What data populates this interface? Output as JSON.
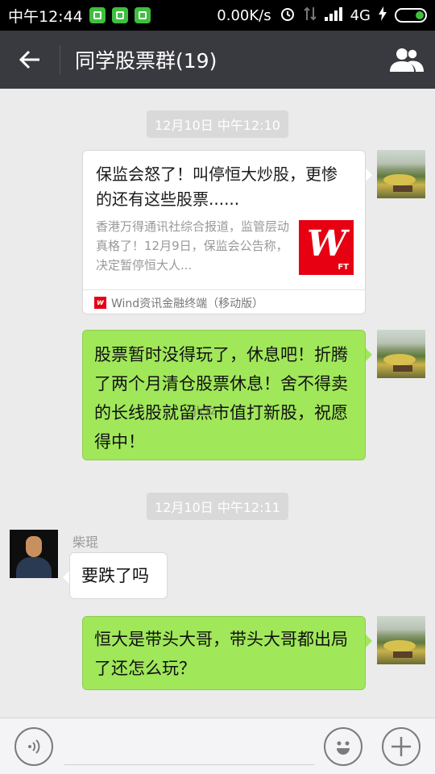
{
  "status_bar": {
    "time": "中午12:44",
    "net_speed": "0.00K/s",
    "network": "4G",
    "notification_icons": [
      "wechat-notif-icon",
      "shield-notif-icon",
      "phone-notif-icon"
    ]
  },
  "header": {
    "title": "同学股票群(19)"
  },
  "messages": {
    "timestamp_1": "12月10日 中午12:10",
    "link_card": {
      "title": "保监会怒了！叫停恒大炒股，更惨的还有这些股票......",
      "description": "香港万得通讯社综合报道，监管层动真格了！12月9日，保监会公告称，决定暂停恒大人...",
      "thumb_letter": "W",
      "thumb_tag": "FT",
      "source": "Wind资讯金融终端（移动版）"
    },
    "msg_1": "股票暂时没得玩了，休息吧！折腾了两个月清仓股票休息！舍不得卖的长线股就留点市值打新股，祝愿得中！",
    "watermark": "jlctz",
    "timestamp_2": "12月10日 中午12:11",
    "sender_name": "柴琨",
    "msg_2": "要跌了吗",
    "msg_3": "恒大是带头大哥，带头大哥都出局了还怎么玩？"
  },
  "colors": {
    "title_bar": "#393a3f",
    "chat_bg": "#ebebeb",
    "bubble_green": "#a0e75a",
    "wind_red": "#e60012"
  }
}
